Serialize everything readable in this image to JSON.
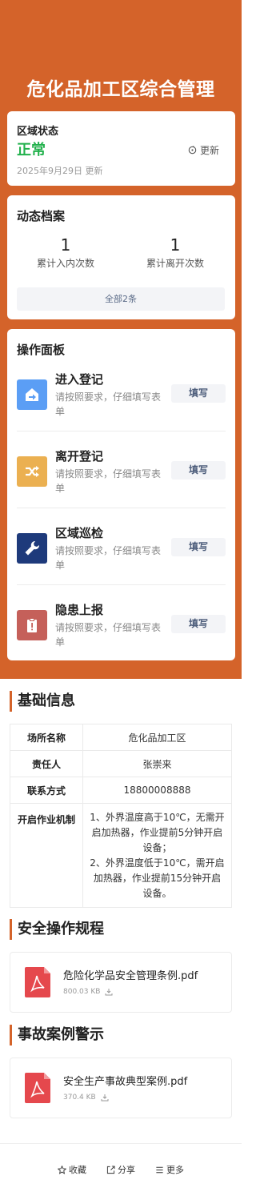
{
  "header": {
    "title": "危化品加工区综合管理"
  },
  "status_card": {
    "label": "区域状态",
    "value": "正常",
    "refresh_label": "更新",
    "updated_at": "2025年9月29日 更新"
  },
  "archive": {
    "title": "动态档案",
    "stats": [
      {
        "value": "1",
        "label": "累计入内次数"
      },
      {
        "value": "1",
        "label": "累计离开次数"
      }
    ],
    "all_label": "全部2条"
  },
  "ops": {
    "title": "操作面板",
    "items": [
      {
        "name": "进入登记",
        "desc": "请按照要求，仔细填写表单",
        "button": "填写",
        "icon": "enter-icon",
        "color": "#5b9ef5"
      },
      {
        "name": "离开登记",
        "desc": "请按照要求，仔细填写表单",
        "button": "填写",
        "icon": "shuffle-icon",
        "color": "#ebb051"
      },
      {
        "name": "区域巡检",
        "desc": "请按照要求，仔细填写表单",
        "button": "填写",
        "icon": "wrench-icon",
        "color": "#1e3a7b"
      },
      {
        "name": "隐患上报",
        "desc": "请按照要求，仔细填写表单",
        "button": "填写",
        "icon": "clipboard-alert-icon",
        "color": "#c5605a"
      }
    ]
  },
  "basic_info": {
    "title": "基础信息",
    "rows": [
      {
        "key": "场所名称",
        "value": "危化品加工区"
      },
      {
        "key": "责任人",
        "value": "张崇来"
      },
      {
        "key": "联系方式",
        "value": "18800008888"
      },
      {
        "key": "开启作业机制",
        "value": "1、外界温度高于10℃，无需开启加热器，作业提前5分钟开启设备；\n2、外界温度低于10℃，需开启加热器，作业提前15分钟开启设备。"
      }
    ]
  },
  "rules": {
    "title": "安全操作规程",
    "file": {
      "name": "危险化学品安全管理条例.pdf",
      "size": "800.03 KB",
      "icon": "pdf-icon"
    }
  },
  "cases": {
    "title": "事故案例警示",
    "file": {
      "name": "安全生产事故典型案例.pdf",
      "size": "370.4 KB",
      "icon": "pdf-icon"
    }
  },
  "bottom_bar": {
    "favorite": "收藏",
    "share": "分享",
    "more": "更多"
  },
  "colors": {
    "brand": "#d4632a",
    "status_ok": "#22b14c",
    "link": "#4a6b9a"
  }
}
